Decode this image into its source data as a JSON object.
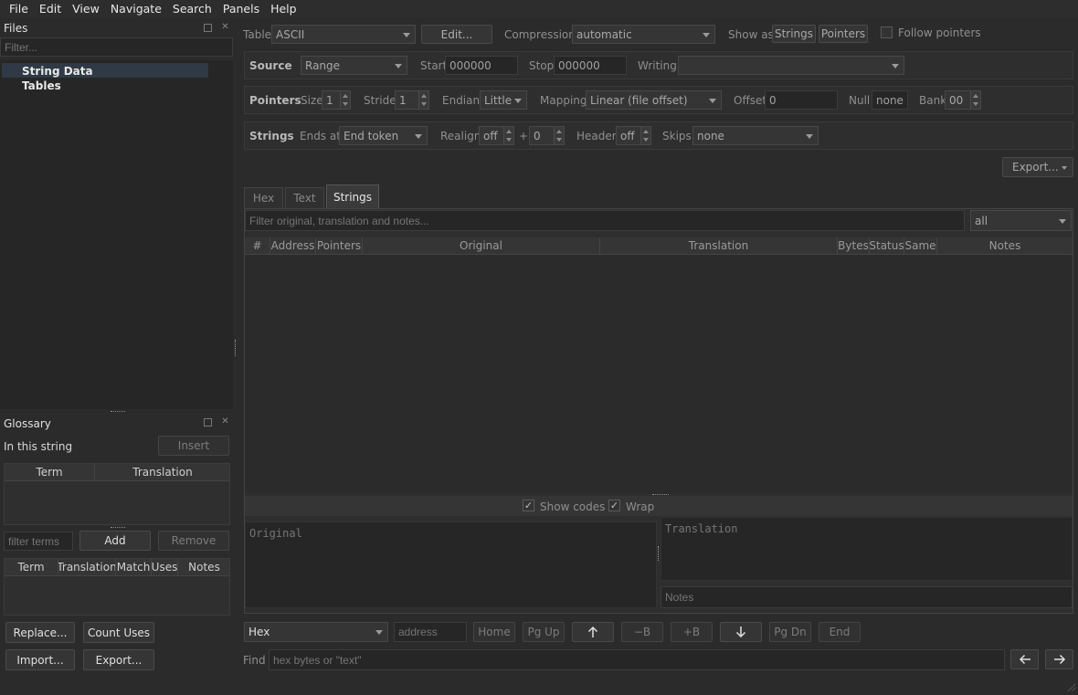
{
  "menu": [
    "File",
    "Edit",
    "View",
    "Navigate",
    "Search",
    "Panels",
    "Help"
  ],
  "files": {
    "title": "Files",
    "filter_placeholder": "Filter...",
    "items": [
      "String Data",
      "Tables"
    ]
  },
  "glossary": {
    "title": "Glossary",
    "in_string_label": "In this string",
    "insert_label": "Insert",
    "table1_headers": [
      "Term",
      "Translation"
    ],
    "filter_placeholder": "filter terms",
    "add_label": "Add",
    "remove_label": "Remove",
    "table2_headers": [
      "Term",
      "Translation",
      "Match",
      "Uses",
      "Notes"
    ],
    "replace_label": "Replace...",
    "count_uses_label": "Count Uses",
    "import_label": "Import...",
    "export_label": "Export..."
  },
  "top": {
    "table_label": "Table",
    "table_value": "ASCII",
    "edit_label": "Edit...",
    "compression_label": "Compression",
    "compression_value": "automatic",
    "show_as_label": "Show as",
    "strings_label": "Strings",
    "pointers_label": "Pointers",
    "follow_pointers_label": "Follow pointers"
  },
  "source": {
    "title": "Source",
    "mode": "Range",
    "start_label": "Start",
    "start_value": "000000",
    "stop_label": "Stop",
    "stop_value": "000000",
    "writing_label": "Writing",
    "writing_value": ""
  },
  "pointers": {
    "title": "Pointers",
    "size_label": "Size",
    "size_value": "1",
    "stride_label": "Stride",
    "stride_value": "1",
    "endian_label": "Endian",
    "endian_value": "Little",
    "mapping_label": "Mapping",
    "mapping_value": "Linear (file offset)",
    "offset_label": "Offset",
    "offset_value": "0",
    "null_label": "Null",
    "null_value": "none",
    "bank_label": "Bank",
    "bank_value": "00"
  },
  "strings": {
    "title": "Strings",
    "ends_at_label": "Ends at",
    "ends_at_value": "End token",
    "realign_label": "Realign",
    "realign_value": "off",
    "plus": "+",
    "realign_extra": "0",
    "header_label": "Header",
    "header_value": "off",
    "skips_label": "Skips",
    "skips_value": "none"
  },
  "export_label": "Export...",
  "tabs": [
    "Hex",
    "Text",
    "Strings"
  ],
  "string_filter_placeholder": "Filter original, translation and notes...",
  "string_filter_scope": "all",
  "columns": [
    "#",
    "Address",
    "Pointers",
    "Original",
    "Translation",
    "Bytes",
    "Status",
    "Same",
    "Notes"
  ],
  "editor": {
    "show_codes_label": "Show codes",
    "wrap_label": "Wrap",
    "original_placeholder": "Original",
    "translation_placeholder": "Translation",
    "notes_placeholder": "Notes"
  },
  "nav": {
    "mode": "Hex",
    "address_placeholder": "address",
    "home": "Home",
    "pgup": "Pg Up",
    "minus_b": "−B",
    "plus_b": "+B",
    "pgdn": "Pg Dn",
    "end": "End",
    "up_icon": "arrow-up-icon",
    "down_icon": "arrow-down-icon"
  },
  "find": {
    "label": "Find",
    "placeholder": "hex bytes or \"text\"",
    "prev_icon": "arrow-left-icon",
    "next_icon": "arrow-right-icon"
  }
}
